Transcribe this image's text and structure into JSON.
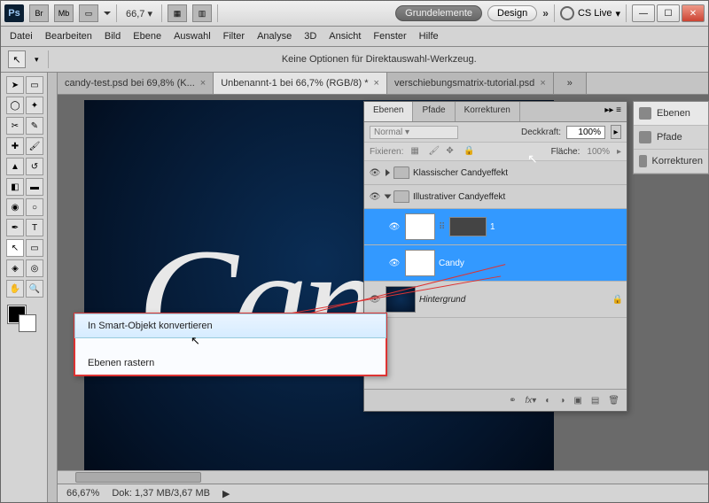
{
  "titlebar": {
    "ps": "Ps",
    "br": "Br",
    "mb": "Mb",
    "zoom": "66,7",
    "workspace_active": "Grundelemente",
    "workspace_2": "Design",
    "cslive": "CS Live"
  },
  "menubar": [
    "Datei",
    "Bearbeiten",
    "Bild",
    "Ebene",
    "Auswahl",
    "Filter",
    "Analyse",
    "3D",
    "Ansicht",
    "Fenster",
    "Hilfe"
  ],
  "options_message": "Keine Optionen für Direktauswahl-Werkzeug.",
  "tabs": [
    {
      "label": "candy-test.psd bei 69,8% (K...",
      "active": false
    },
    {
      "label": "Unbenannt-1 bei 66,7% (RGB/8) *",
      "active": true
    },
    {
      "label": "verschiebungsmatrix-tutorial.psd",
      "active": false
    }
  ],
  "canvas_text": "Can",
  "layers_panel": {
    "tabs": [
      "Ebenen",
      "Pfade",
      "Korrekturen"
    ],
    "active_tab": 0,
    "blend_mode": "Normal",
    "opacity_label": "Deckkraft:",
    "opacity_value": "100%",
    "lock_label": "Fixieren:",
    "fill_label": "Fläche:",
    "fill_value": "100%",
    "groups": [
      {
        "name": "Klassischer Candyeffekt",
        "open": false
      },
      {
        "name": "Illustrativer Candyeffekt",
        "open": true
      }
    ],
    "layers": [
      {
        "name": "1",
        "selected": true,
        "type": "shape"
      },
      {
        "name": "Candy",
        "selected": true,
        "type": "text"
      },
      {
        "name": "Hintergrund",
        "selected": false,
        "type": "bg"
      }
    ]
  },
  "context_menu": {
    "items": [
      "In Smart-Objekt konvertieren",
      "Ebenen rastern"
    ],
    "hover": 0
  },
  "right_panel": [
    "Ebenen",
    "Pfade",
    "Korrekturen"
  ],
  "statusbar": {
    "zoom": "66,67%",
    "doc": "Dok: 1,37 MB/3,67 MB"
  }
}
